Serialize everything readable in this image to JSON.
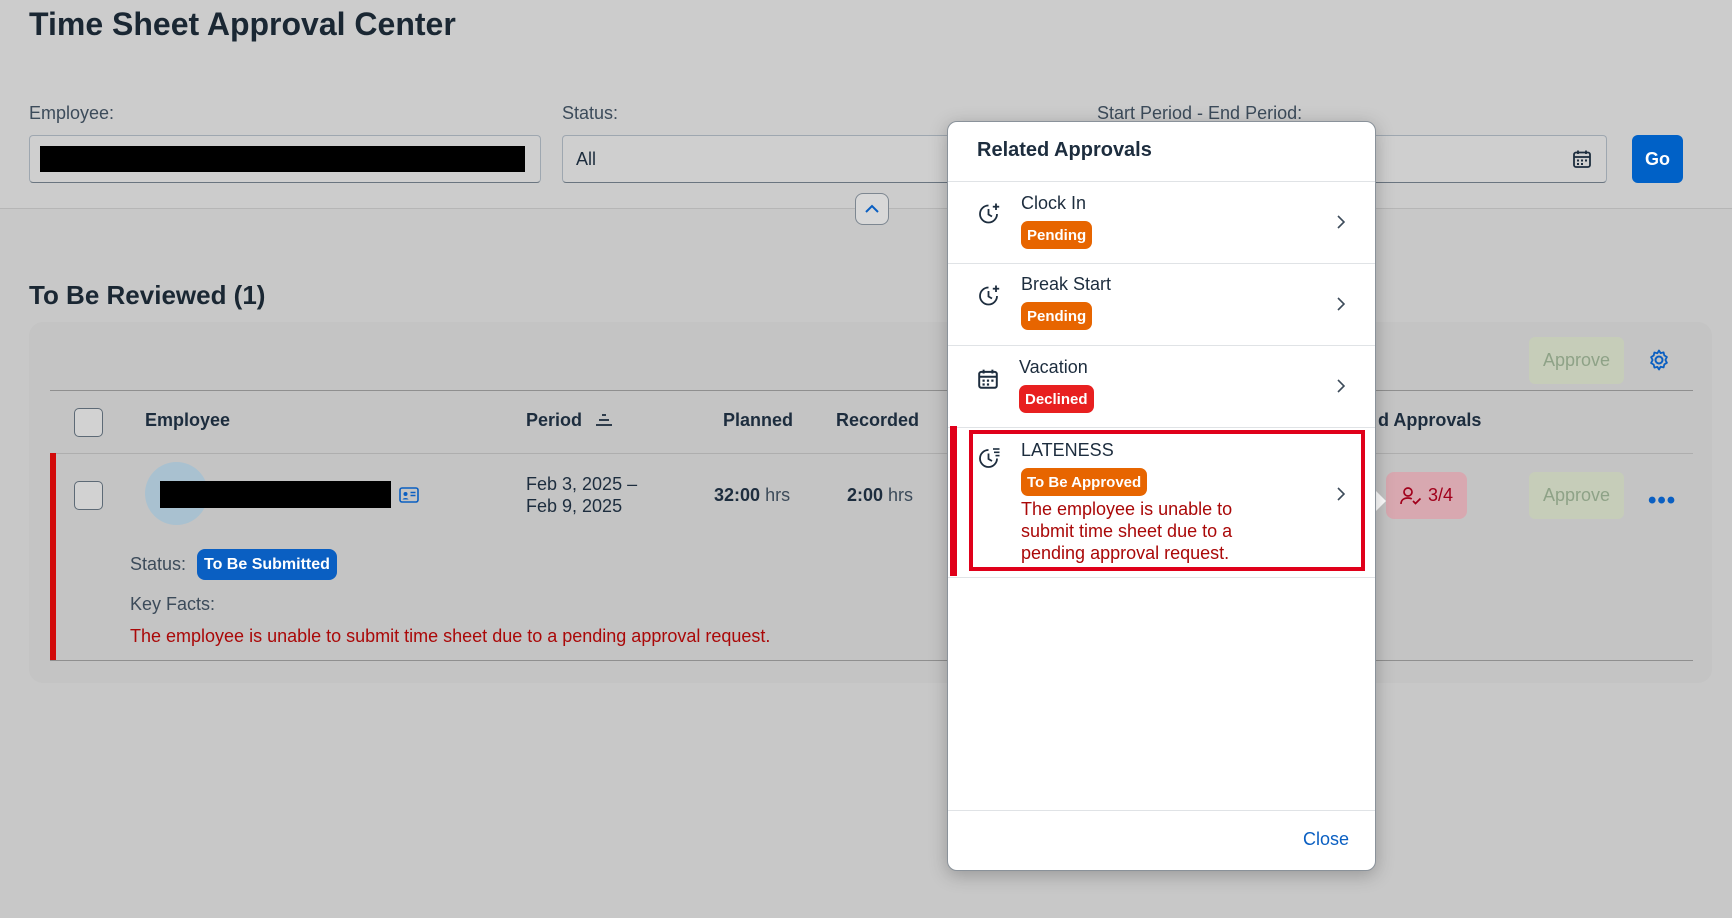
{
  "page": {
    "title": "Time Sheet Approval Center"
  },
  "filters": {
    "employee_label": "Employee:",
    "status_label": "Status:",
    "status_value": "All",
    "period_label": "Start Period - End Period:",
    "go_label": "Go"
  },
  "section": {
    "title": "To Be Reviewed (1)"
  },
  "table": {
    "approve_header_label": "Approve",
    "columns": {
      "employee": "Employee",
      "period": "Period",
      "planned": "Planned",
      "recorded": "Recorded",
      "approvals": "d Approvals"
    },
    "row": {
      "period_start": "Feb 3, 2025 –",
      "period_end": "Feb 9, 2025",
      "planned_value": "32:00",
      "recorded_value": "2:00",
      "hrs_unit": "hrs",
      "approvals_count": "3/4",
      "approve_label": "Approve",
      "more": "•••",
      "status_label": "Status:",
      "status_badge": "To Be Submitted",
      "key_facts_label": "Key Facts:",
      "key_facts_text": "The employee is unable to submit time sheet due to a pending approval request."
    }
  },
  "popover": {
    "title": "Related Approvals",
    "items": [
      {
        "label": "Clock In",
        "status": "Pending",
        "icon": "clock-add-icon"
      },
      {
        "label": "Break Start",
        "status": "Pending",
        "icon": "clock-add-icon"
      },
      {
        "label": "Vacation",
        "status": "Declined",
        "icon": "calendar-icon"
      },
      {
        "label": "LATENESS",
        "status": "To Be Approved",
        "icon": "clock-list-icon",
        "message": "The employee is unable to submit time sheet due to a pending approval request."
      }
    ],
    "close_label": "Close"
  },
  "colors": {
    "accent": "#0a5fc2",
    "pending": "#e76500",
    "declined": "#e82020",
    "error_text": "#aa0808"
  }
}
